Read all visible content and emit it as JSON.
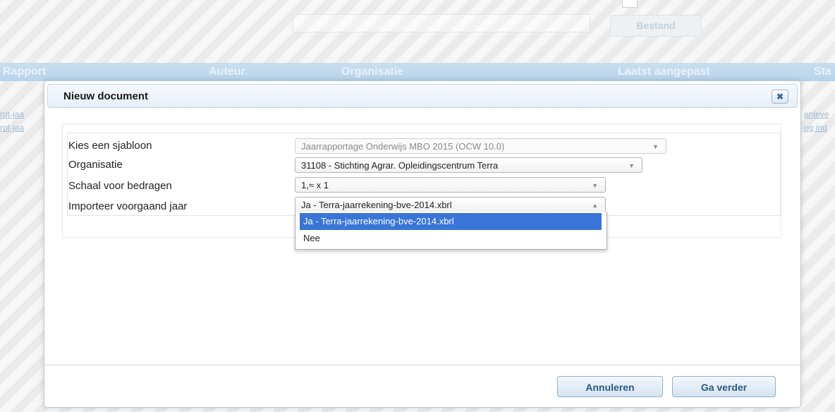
{
  "background": {
    "file_button": "Bestand",
    "columns": [
      "Rapport",
      "Auteur",
      "Organisatie",
      "Laatst aangepast",
      "Sta"
    ],
    "links_left": [
      "rpt-jaa",
      "rpt-jaa"
    ],
    "links_right": [
      "anleve",
      "og ind"
    ]
  },
  "modal": {
    "title": "Nieuw document",
    "close_icon": "close-icon",
    "fields": [
      {
        "label": "Kies een sjabloon",
        "value": "Jaarrapportage Onderwijs MBO 2015 (OCW 10.0)"
      },
      {
        "label": "Organisatie",
        "value": "31108 - Stichting Agrar. Opleidingscentrum Terra"
      },
      {
        "label": "Schaal voor bedragen",
        "value": "1,≈ x 1"
      },
      {
        "label": "Importeer voorgaand jaar",
        "value": "Ja - Terra-jaarrekening-bve-2014.xbrl"
      }
    ],
    "dropdown_options": [
      "Ja - Terra-jaarrekening-bve-2014.xbrl",
      "Nee"
    ],
    "cancel_label": "Annuleren",
    "continue_label": "Ga verder"
  },
  "colors": {
    "accent": "#3875d7",
    "button_text": "#2a5a86",
    "header_bar": "#b7d3ea"
  }
}
